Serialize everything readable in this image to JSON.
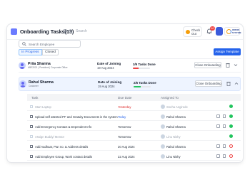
{
  "header": {
    "title": "Onboarding Tasks(13)",
    "search_placeholder": "Search",
    "checkout_label": "Check Out",
    "notif_count": "10",
    "brand_text": "ORION SYSTEM"
  },
  "filters": {
    "search_placeholder": "Search Employee",
    "tabs": [
      "In Progress",
      "Closed"
    ],
    "assign_label": "Assign Template"
  },
  "employees": [
    {
      "name": "Priia Sharma",
      "sub": "ABE2021 | President | Corporate Office",
      "doj_label": "Date of Joining",
      "doj": "19 Aug 2024",
      "tasks": "3/9 Tasks Done",
      "progress": 0.33,
      "bar_color": "#ef4444",
      "close_label": "Close Onboarding"
    },
    {
      "name": "Rahul Sharma",
      "sub": "Customer",
      "doj_label": "Date of Joining",
      "doj": "19 Aug 2024",
      "tasks": "2/5 Tasks Done",
      "progress": 0.4,
      "bar_color": "#22c55e",
      "close_label": "Close Onboarding"
    }
  ],
  "table": {
    "headers": [
      "Task",
      "Due Date",
      "Assigned To"
    ],
    "rows": [
      {
        "task": "Start Laptop",
        "due": "Yesterday",
        "assignee": "Sneha Angirede",
        "done": true,
        "due_style": "red",
        "status": "ok"
      },
      {
        "task": "Upload self attested PF and Gratuity Documents in the system",
        "due": "Today",
        "assignee": "Rahul Sharma",
        "done": false,
        "due_style": "blue",
        "status": "ok"
      },
      {
        "task": "Add Emergency Contact & Dependent Info",
        "due": "Tomorrow",
        "assignee": "Rahul Sharma",
        "done": false,
        "due_style": "",
        "status": "ok"
      },
      {
        "task": "Assign Buddy/ Mentor",
        "due": "Tomorrow",
        "assignee": "Linu Nishy",
        "done": true,
        "due_style": "",
        "status": "ok"
      },
      {
        "task": "Add Aadhaar, Pan no. & Address details",
        "due": "20 Aug 2024",
        "assignee": "Rahul Sharma",
        "done": false,
        "due_style": "",
        "status": "bad"
      },
      {
        "task": "Add Employee Group, Work contact details",
        "due": "22 Aug 2024",
        "assignee": "Linu Nishy",
        "done": false,
        "due_style": "",
        "status": "bad"
      }
    ]
  },
  "colors": {
    "accent": "#2563eb",
    "danger": "#ef4444",
    "success": "#22c55e"
  }
}
